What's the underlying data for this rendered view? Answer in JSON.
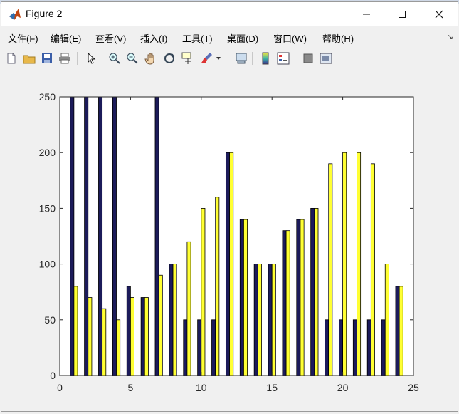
{
  "window": {
    "title": "Figure 2"
  },
  "menus": [
    "文件(F)",
    "编辑(E)",
    "查看(V)",
    "插入(I)",
    "工具(T)",
    "桌面(D)",
    "窗口(W)",
    "帮助(H)"
  ],
  "toolbar_icons": [
    "new-file-icon",
    "open-folder-icon",
    "save-icon",
    "print-icon",
    "pointer-icon",
    "zoom-in-icon",
    "zoom-out-icon",
    "pan-hand-icon",
    "rotate-3d-icon",
    "data-cursor-icon",
    "brush-icon",
    "link-plot-icon",
    "colorbar-icon",
    "legend-icon",
    "hide-plot-tools-icon",
    "show-plot-tools-icon"
  ],
  "chart_data": {
    "type": "bar",
    "title": "",
    "xlabel": "",
    "ylabel": "",
    "xlim": [
      0,
      25
    ],
    "ylim": [
      0,
      250
    ],
    "xticks": [
      "0",
      "5",
      "10",
      "15",
      "20",
      "25"
    ],
    "yticks": [
      "0",
      "50",
      "100",
      "150",
      "200",
      "250"
    ],
    "grid": false,
    "x": [
      1,
      2,
      3,
      4,
      5,
      6,
      7,
      8,
      9,
      10,
      11,
      12,
      13,
      14,
      15,
      16,
      17,
      18,
      19,
      20,
      21,
      22,
      23,
      24
    ],
    "series": [
      {
        "color": "#1c1b5a",
        "values": [
          250,
          250,
          250,
          250,
          80,
          70,
          250,
          100,
          50,
          50,
          50,
          200,
          140,
          100,
          100,
          130,
          140,
          150,
          50,
          50,
          50,
          50,
          50,
          80
        ]
      },
      {
        "color": "#ffff33",
        "values": [
          80,
          70,
          60,
          50,
          70,
          70,
          90,
          100,
          120,
          150,
          160,
          200,
          140,
          100,
          100,
          130,
          140,
          150,
          190,
          200,
          200,
          190,
          100,
          80
        ]
      }
    ]
  }
}
